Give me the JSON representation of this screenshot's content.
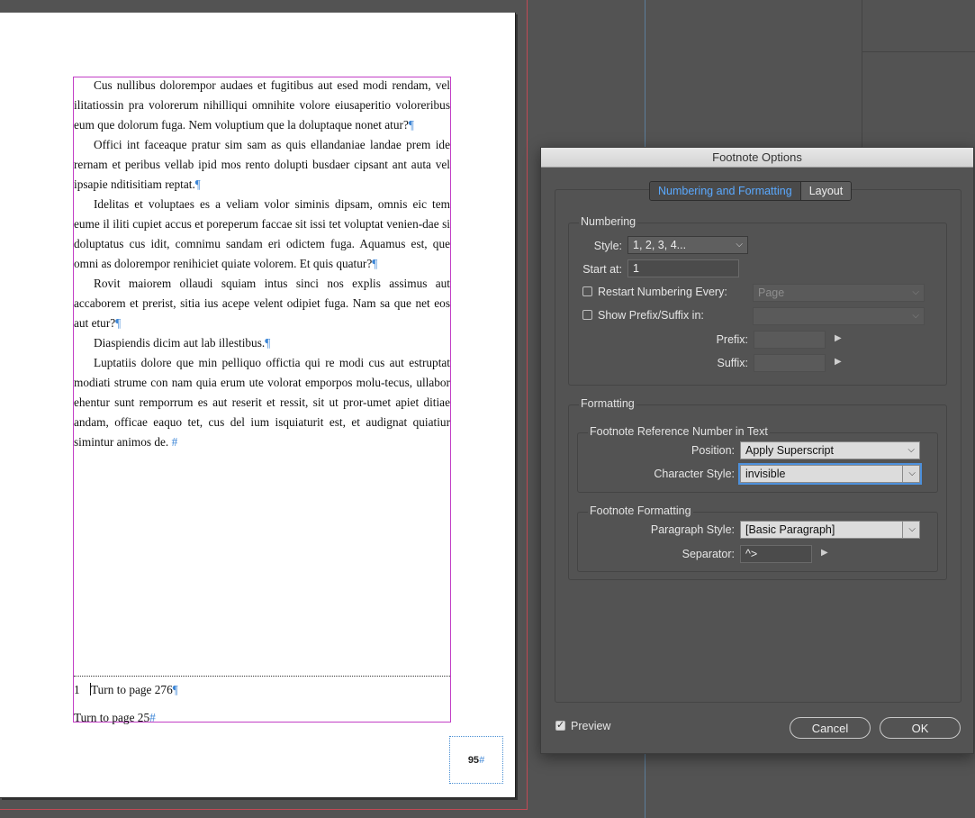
{
  "document": {
    "paragraphs": [
      "Cus nullibus dolorempor audaes et fugitibus aut esed modi rendam, vel ilitatiossin pra volorerum nihilliqui omnihite volore eiusaperitio voloreribus eum que dolorum fuga. Nem voluptium que la doluptaque nonet atur?",
      "Offici int faceaque pratur sim sam as quis ellandaniae landae prem ide rernam et peribus vellab ipid mos rento dolupti busdaer cipsant ant auta vel ipsapie nditisitiam reptat.",
      "Idelitas et voluptaes es a veliam volor siminis dipsam, omnis eic tem eume il iliti cupiet accus et poreperum faccae sit issi tet voluptat venien-dae si doluptatus cus idit, comnimu sandam eri odictem fuga. Aquamus est, que omni as dolorempor renihiciet quiate volorem. Et quis quatur?",
      "Rovit maiorem ollaudi squiam intus sinci nos explis assimus aut accaborem et prerist, sitia ius acepe velent odipiet fuga. Nam sa que net eos aut etur?",
      "Diaspiendis dicim aut lab illestibus.",
      "Luptatiis dolore que min pelliquo offictia qui re modi cus aut estruptat modiati strume con nam quia erum ute volorat emporpos molu-tecus, ullabor ehentur sunt remporrum es aut reserit et ressit, sit ut pror-umet apiet ditiae andam, officae eaquo tet, cus del ium isquiaturit est, et audignat quiatiur simintur animos de."
    ],
    "pilcrow": "¶",
    "end_mark": "#",
    "footnote_number": "1",
    "footnote_text": "Turn to page 276",
    "footnote_text2": "Turn to page 25",
    "page_number": "95"
  },
  "dialog": {
    "title": "Footnote Options",
    "tabs": [
      "Numbering and Formatting",
      "Layout"
    ],
    "active_tab": "Numbering and Formatting",
    "numbering": {
      "section_title": "Numbering",
      "style_label": "Style:",
      "style_value": "1, 2, 3, 4...",
      "start_label": "Start at:",
      "start_value": "1",
      "restart_label": "Restart Numbering Every:",
      "restart_checked": false,
      "restart_value": "Page",
      "prefix_suffix_label": "Show Prefix/Suffix in:",
      "prefix_suffix_checked": false,
      "prefix_suffix_value": "",
      "prefix_label": "Prefix:",
      "prefix_value": "",
      "suffix_label": "Suffix:",
      "suffix_value": ""
    },
    "formatting": {
      "section_title": "Formatting",
      "ref_group_title": "Footnote Reference Number in Text",
      "position_label": "Position:",
      "position_value": "Apply Superscript",
      "char_style_label": "Character Style:",
      "char_style_value": "invisible",
      "fn_group_title": "Footnote Formatting",
      "para_style_label": "Paragraph Style:",
      "para_style_value": "[Basic Paragraph]",
      "separator_label": "Separator:",
      "separator_value": "^>"
    },
    "preview_label": "Preview",
    "preview_checked": true,
    "cancel_label": "Cancel",
    "ok_label": "OK"
  },
  "colors": {
    "accent": "#5aa9ff",
    "frame": "#c23fc6",
    "bleed": "#c04a55"
  },
  "icons": {
    "dropdown": "chevron-down-icon",
    "popout": "triangle-right-icon",
    "check": "checkmark-icon"
  }
}
